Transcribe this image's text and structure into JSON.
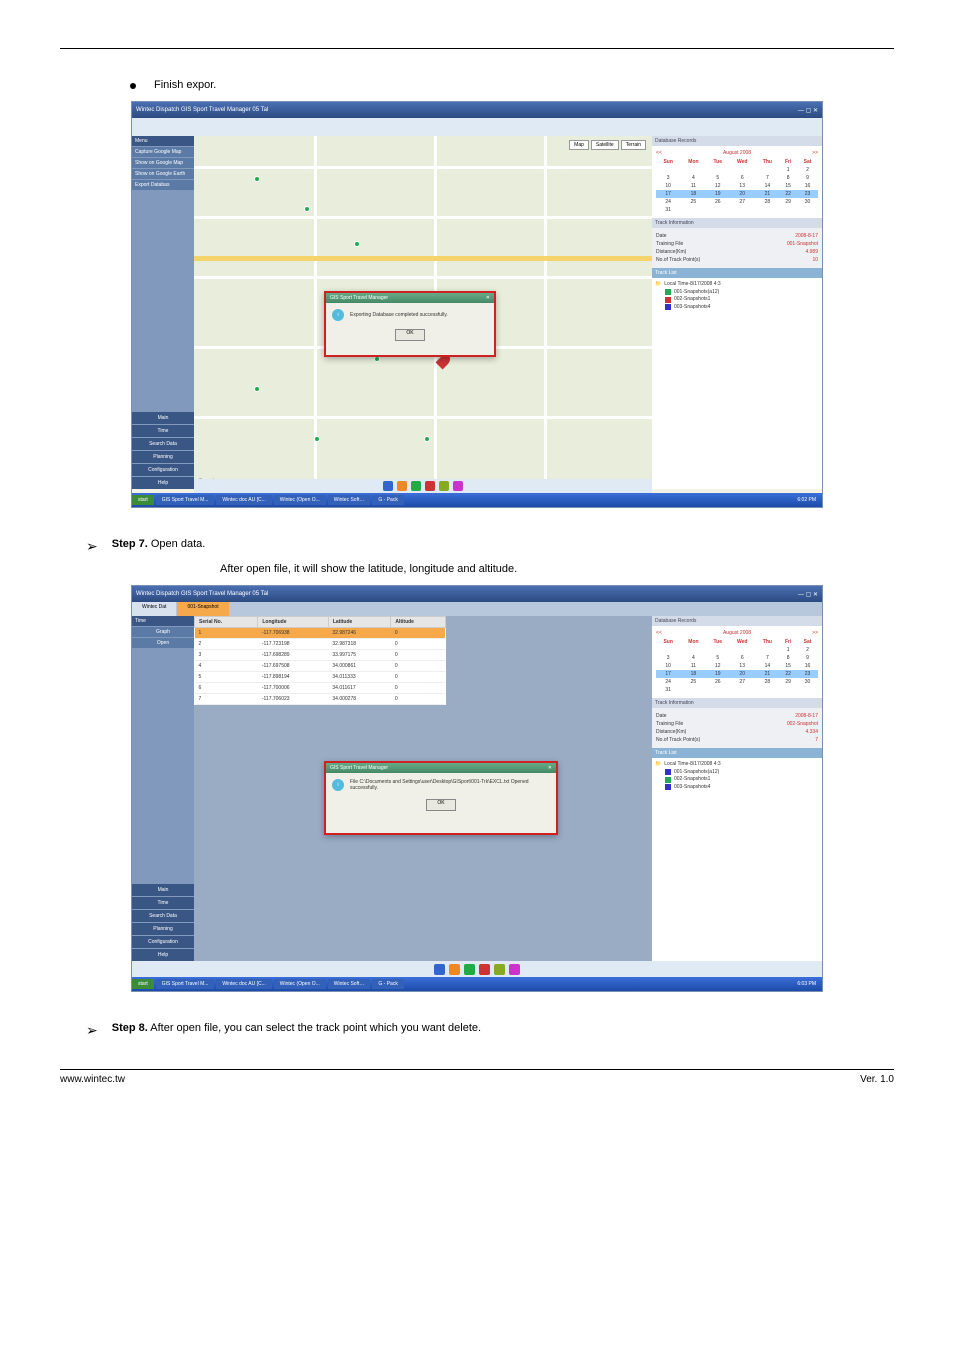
{
  "doc": {
    "bullet_text": "Finish expor.",
    "step7_label": "Step 7.",
    "step7_text": "Open data.",
    "step7_sub": "After open file, it will show the latitude, longitude and altitude.",
    "step8_label": "Step 8.",
    "step8_text": "After open file, you can select the track point which you want delete.",
    "footer_left": "www.wintec.tw",
    "footer_right": "Ver. 1.0"
  },
  "shot1": {
    "window_title": "Wintec Dispatch GIS Sport Travel Manager 05 Tal",
    "leftnav_header": "Menu",
    "leftnav_items": [
      "Capture Google Map",
      "Show on Google Map",
      "Show on Google Earth",
      "Export Databas"
    ],
    "leftnav_bottom": [
      "Main",
      "Time",
      "Search Data",
      "Planning",
      "Configuration",
      "Help"
    ],
    "map_buttons": [
      "Map",
      "Satellite",
      "Terrain"
    ],
    "modal_title": "GIS Sport Travel Manager",
    "modal_text": "Exporting Database completed successfully.",
    "modal_ok": "OK",
    "google_logo": "Google",
    "rpanel": {
      "records_hdr": "Database Records",
      "month_nav_left": "<<",
      "month_label": "August",
      "year_label": "2008",
      "month_nav_right": ">>",
      "dow": [
        "Sun",
        "Mon",
        "Tue",
        "Wed",
        "Thu",
        "Fri",
        "Sat"
      ],
      "weeks": [
        [
          "",
          "",
          "",
          "",
          "",
          "1",
          "2"
        ],
        [
          "3",
          "4",
          "5",
          "6",
          "7",
          "8",
          "9"
        ],
        [
          "10",
          "11",
          "12",
          "13",
          "14",
          "15",
          "16"
        ],
        [
          "17",
          "18",
          "19",
          "20",
          "21",
          "22",
          "23"
        ],
        [
          "24",
          "25",
          "26",
          "27",
          "28",
          "29",
          "30"
        ],
        [
          "31",
          "",
          "",
          "",
          "",
          "",
          ""
        ]
      ],
      "hl_row": 3,
      "track_info_hdr": "Track Information",
      "info": [
        {
          "k": "Date",
          "v": "2008-8-17"
        },
        {
          "k": "Training File",
          "v": "001-Snapshot"
        },
        {
          "k": "Distance(Km)",
          "v": "4.989"
        },
        {
          "k": "No.of Track Point(s)",
          "v": "10"
        }
      ],
      "tracklist_hdr": "Track List",
      "tracklist_root": "Local Time-8/17/2008 4:3",
      "tracklist_items": [
        {
          "flag": "#2a5",
          "t": "001-Snapshots(a12)"
        },
        {
          "flag": "#c33",
          "t": "002-Snapshots1"
        },
        {
          "flag": "#33c",
          "t": "003-Snapshots4"
        }
      ]
    },
    "taskbar": {
      "start": "start",
      "items": [
        "GIS Sport Travel M...",
        "Wintec doc AU [C...",
        "Wintec (Open O...",
        "Wintec Soft…",
        "G - Pack"
      ],
      "tray": "6:02 PM"
    }
  },
  "shot2": {
    "window_title": "Wintec Dispatch GIS Sport Travel Manager 05 Tal",
    "tab_left": "Wintec Dat",
    "tab_active": "001-Snapshot",
    "leftnav_header": "Time",
    "leftnav_items": [
      "Graph",
      "Open"
    ],
    "leftnav_bottom": [
      "Main",
      "Time",
      "Search Data",
      "Planning",
      "Configuration",
      "Help"
    ],
    "table": {
      "headers": [
        "Serial No.",
        "Longitude",
        "Latitude",
        "Altitude"
      ],
      "rows": [
        [
          "1",
          "-117.706938",
          "32.987246",
          "0"
        ],
        [
          "2",
          "-117.723198",
          "32.987318",
          "0"
        ],
        [
          "3",
          "-117.698289",
          "33.997175",
          "0"
        ],
        [
          "4",
          "-117.697508",
          "34.000861",
          "0"
        ],
        [
          "5",
          "-117.898194",
          "34.011333",
          "0"
        ],
        [
          "6",
          "-117.700006",
          "34.011617",
          "0"
        ],
        [
          "7",
          "-117.706023",
          "34.000278",
          "0"
        ]
      ],
      "hl_row": 0
    },
    "modal_title": "GIS Sport Travel Manager",
    "modal_text": "File C:\\Documents and Settings\\user\\Desktop\\GISport\\001-Trk\\EXCL.txt Opened successfully.",
    "modal_ok": "OK",
    "rpanel": {
      "records_hdr": "Database Records",
      "month_nav_left": "<<",
      "month_label": "August",
      "year_label": "2008",
      "month_nav_right": ">>",
      "dow": [
        "Sun",
        "Mon",
        "Tue",
        "Wed",
        "Thu",
        "Fri",
        "Sat"
      ],
      "weeks": [
        [
          "",
          "",
          "",
          "",
          "",
          "1",
          "2"
        ],
        [
          "3",
          "4",
          "5",
          "6",
          "7",
          "8",
          "9"
        ],
        [
          "10",
          "11",
          "12",
          "13",
          "14",
          "15",
          "16"
        ],
        [
          "17",
          "18",
          "19",
          "20",
          "21",
          "22",
          "23"
        ],
        [
          "24",
          "25",
          "26",
          "27",
          "28",
          "29",
          "30"
        ],
        [
          "31",
          "",
          "",
          "",
          "",
          "",
          ""
        ]
      ],
      "hl_row": 3,
      "track_info_hdr": "Track Information",
      "info": [
        {
          "k": "Date",
          "v": "2008-8-17"
        },
        {
          "k": "Training File",
          "v": "002-Snapshot"
        },
        {
          "k": "Distance(Km)",
          "v": "4.334"
        },
        {
          "k": "No.of Track Point(s)",
          "v": "7"
        }
      ],
      "tracklist_hdr": "Track List",
      "tracklist_root": "Local Time-8/17/2008 4:3",
      "tracklist_items": [
        {
          "flag": "#33c",
          "t": "001-Snapshots(a12)"
        },
        {
          "flag": "#2a5",
          "t": "002-Snapshots1"
        },
        {
          "flag": "#33c",
          "t": "003-Snapshots4"
        }
      ]
    },
    "taskbar": {
      "start": "start",
      "items": [
        "GIS Sport Travel M...",
        "Wintec doc AU [C...",
        "Wintec (Open O...",
        "Wintec Soft…",
        "G - Pack"
      ],
      "tray": "6:03 PM"
    }
  }
}
